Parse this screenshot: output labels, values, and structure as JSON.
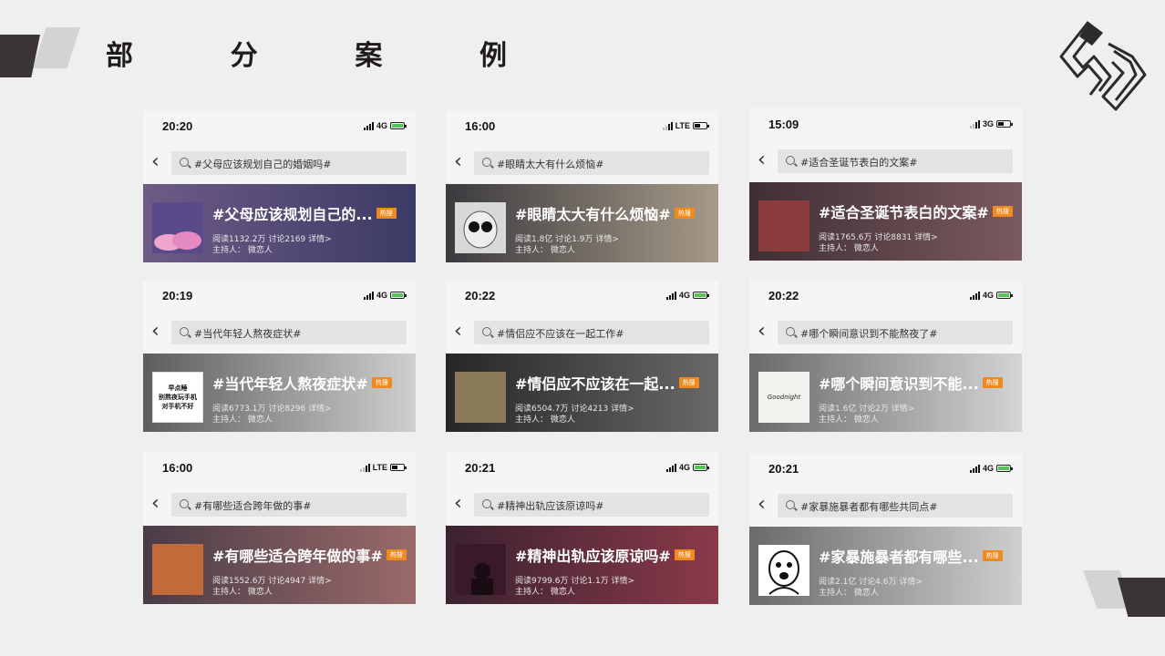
{
  "page": {
    "title_chars": [
      "部",
      "分",
      "案",
      "例"
    ]
  },
  "cards": [
    {
      "time": "20:20",
      "network": "4G",
      "query": "#父母应该规划自己的婚姻吗#",
      "topic": "#父母应该规划自己的...",
      "badge": "热搜",
      "stats": "阅读1132.2万  讨论2169  详情>",
      "host": "主持人：  微恋人",
      "colors": {
        "banner_from": "#6e5b86",
        "banner_to": "#3b3b66",
        "thumb": "#d88cb8"
      }
    },
    {
      "time": "16:00",
      "network": "LTE",
      "query": "#眼睛太大有什么烦恼#",
      "topic": "#眼睛太大有什么烦恼#",
      "badge": "热搜",
      "stats": "阅读1.8亿  讨论1.9万  详情>",
      "host": "主持人：  微恋人",
      "colors": {
        "banner_from": "#3c3a3f",
        "banner_to": "#a69a88",
        "thumb": "#cfcfcf"
      }
    },
    {
      "time": "15:09",
      "network": "3G",
      "query": "#适合圣诞节表白的文案#",
      "topic": "#适合圣诞节表白的文案#",
      "badge": "热搜",
      "stats": "阅读1765.6万  讨论8831  详情>",
      "host": "主持人：  微恋人",
      "colors": {
        "banner_from": "#3f2f35",
        "banner_to": "#7a5a5e",
        "thumb": "#8a3b3b"
      }
    },
    {
      "time": "20:19",
      "network": "4G",
      "query": "#当代年轻人熬夜症状#",
      "topic": "#当代年轻人熬夜症状#",
      "badge": "热搜",
      "stats": "阅读6773.1万  讨论8296  详情>",
      "host": "主持人：  微恋人",
      "colors": {
        "banner_from": "#5d5d5d",
        "banner_to": "#cfcfcf",
        "thumb": "#ffffff"
      }
    },
    {
      "time": "20:22",
      "network": "4G",
      "query": "#情侣应不应该在一起工作#",
      "topic": "#情侣应不应该在一起...",
      "badge": "热搜",
      "stats": "阅读6504.7万  讨论4213  详情>",
      "host": "主持人：  微恋人",
      "colors": {
        "banner_from": "#252625",
        "banner_to": "#6b6868",
        "thumb": "#8a7a5a"
      }
    },
    {
      "time": "20:22",
      "network": "4G",
      "query": "#哪个瞬间意识到不能熬夜了#",
      "topic": "#哪个瞬间意识到不能...",
      "badge": "热搜",
      "stats": "阅读1.6亿  讨论2万  详情>",
      "host": "主持人：  微恋人",
      "colors": {
        "banner_from": "#6a6a6a",
        "banner_to": "#d4d4d4",
        "thumb": "#f2f2ee"
      }
    },
    {
      "time": "16:00",
      "network": "LTE",
      "query": "#有哪些适合跨年做的事#",
      "topic": "#有哪些适合跨年做的事#",
      "badge": "热搜",
      "stats": "阅读1552.6万  讨论4947  详情>",
      "host": "主持人：  微恋人",
      "colors": {
        "banner_from": "#4a3c47",
        "banner_to": "#9a6a6a",
        "thumb": "#c26a3a"
      }
    },
    {
      "time": "20:21",
      "network": "4G",
      "query": "#精神出轨应该原谅吗#",
      "topic": "#精神出轨应该原谅吗#",
      "badge": "热搜",
      "stats": "阅读9799.6万  讨论1.1万  详情>",
      "host": "主持人：  微恋人",
      "colors": {
        "banner_from": "#3b2230",
        "banner_to": "#8a3a4a",
        "thumb": "#5a2838"
      }
    },
    {
      "time": "20:21",
      "network": "4G",
      "query": "#家暴施暴者都有哪些共同点#",
      "topic": "#家暴施暴者都有哪些...",
      "badge": "热搜",
      "stats": "阅读2.1亿  讨论4.6万  详情>",
      "host": "主持人：  微恋人",
      "colors": {
        "banner_from": "#6a6a6a",
        "banner_to": "#cfcfcf",
        "thumb": "#ffffff"
      }
    }
  ],
  "thumb_texts": {
    "card4": [
      "早点睡",
      "别熬夜玩手机",
      "对手机不好"
    ],
    "card6": "Goodnight"
  },
  "colors": {
    "accent": "#f08a1c",
    "dark": "#3a3436",
    "light": "#d3d3d3"
  }
}
